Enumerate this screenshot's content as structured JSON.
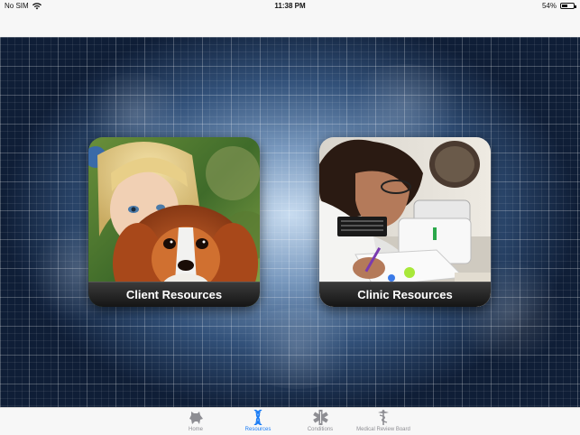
{
  "status_bar": {
    "carrier": "No SIM",
    "time": "11:38 PM",
    "battery_percent": "54%",
    "battery_level": 0.54
  },
  "tiles": [
    {
      "label": "Client Resources",
      "icon": "girl-with-dog-photo"
    },
    {
      "label": "Clinic Resources",
      "icon": "lab-technician-photo"
    }
  ],
  "tab_bar": {
    "active_index": 1,
    "active_color": "#1a7cf5",
    "inactive_color": "#8e8e93",
    "items": [
      {
        "label": "Home",
        "icon": "dog-icon"
      },
      {
        "label": "Resources",
        "icon": "dna-icon"
      },
      {
        "label": "Conditions",
        "icon": "caduceus-star-icon"
      },
      {
        "label": "Medical Review Board",
        "icon": "caduceus-icon"
      }
    ]
  }
}
